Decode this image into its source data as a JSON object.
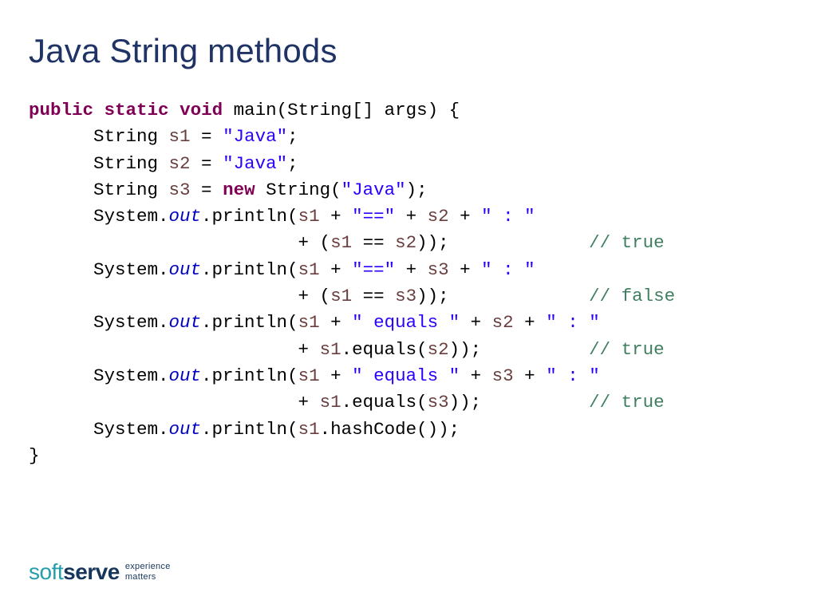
{
  "title": "Java String methods",
  "logo": {
    "soft": "soft",
    "serve": "serve",
    "tag1": "experience",
    "tag2": "matters"
  },
  "code": {
    "l1a": "public",
    "l1b": "static",
    "l1c": "void",
    "l1d": " main(String[] args) {",
    "l2a": "      String ",
    "l2v": "s1",
    "l2b": " = ",
    "l2s": "\"Java\"",
    "l2c": ";",
    "l3a": "      String ",
    "l3v": "s2",
    "l3b": " = ",
    "l3s": "\"Java\"",
    "l3c": ";",
    "l4a": "      String ",
    "l4v": "s3",
    "l4b": " = ",
    "l4n": "new",
    "l4c": " String(",
    "l4s": "\"Java\"",
    "l4d": ");",
    "l5a": "      System.",
    "l5b": "out",
    "l5c": ".println(",
    "l5v1": "s1",
    "l5d": " + ",
    "l5s1": "\"==\"",
    "l5e": " + ",
    "l5v2": "s2",
    "l5f": " + ",
    "l5s2": "\" : \"",
    "l6a": "                         + (",
    "l6v1": "s1",
    "l6b": " == ",
    "l6v2": "s2",
    "l6c": "));             ",
    "l6cm": "// true",
    "l7a": "      System.",
    "l7b": "out",
    "l7c": ".println(",
    "l7v1": "s1",
    "l7d": " + ",
    "l7s1": "\"==\"",
    "l7e": " + ",
    "l7v2": "s3",
    "l7f": " + ",
    "l7s2": "\" : \"",
    "l8a": "                         + (",
    "l8v1": "s1",
    "l8b": " == ",
    "l8v2": "s3",
    "l8c": "));             ",
    "l8cm": "// false",
    "l9a": "      System.",
    "l9b": "out",
    "l9c": ".println(",
    "l9v1": "s1",
    "l9d": " + ",
    "l9s1": "\" equals \"",
    "l9e": " + ",
    "l9v2": "s2",
    "l9f": " + ",
    "l9s2": "\" : \"",
    "l10a": "                         + ",
    "l10v1": "s1",
    "l10b": ".equals(",
    "l10v2": "s2",
    "l10c": "));          ",
    "l10cm": "// true",
    "l11a": "      System.",
    "l11b": "out",
    "l11c": ".println(",
    "l11v1": "s1",
    "l11d": " + ",
    "l11s1": "\" equals \"",
    "l11e": " + ",
    "l11v2": "s3",
    "l11f": " + ",
    "l11s2": "\" : \"",
    "l12a": "                         + ",
    "l12v1": "s1",
    "l12b": ".equals(",
    "l12v2": "s3",
    "l12c": "));          ",
    "l12cm": "// true",
    "l13a": "      System.",
    "l13b": "out",
    "l13c": ".println(",
    "l13v": "s1",
    "l13d": ".hashCode());",
    "l14": "}"
  }
}
